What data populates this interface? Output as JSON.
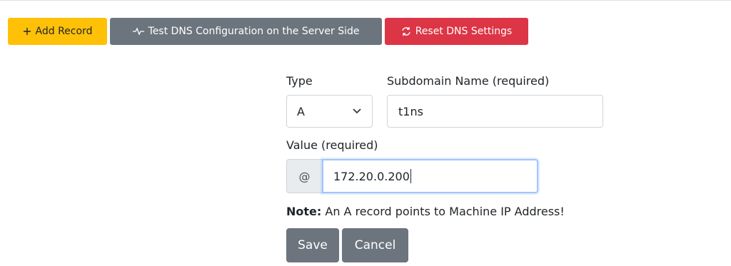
{
  "toolbar": {
    "add_record": {
      "label": "Add Record",
      "icon": "plus-icon"
    },
    "test_dns": {
      "label": "Test DNS Configuration on the Server Side",
      "icon": "pulse-icon"
    },
    "reset_dns": {
      "label": "Reset DNS Settings",
      "icon": "refresh-icon"
    }
  },
  "form": {
    "type_label": "Type",
    "type_value": "A",
    "subdomain_label": "Subdomain Name (required)",
    "subdomain_value": "t1ns",
    "value_label": "Value (required)",
    "value_prefix": "@",
    "value_value": "172.20.0.200",
    "note_prefix": "Note:",
    "note_text": " An A record points to Machine IP Address!",
    "save_label": "Save",
    "cancel_label": "Cancel"
  },
  "colors": {
    "warning": "#ffc107",
    "secondary": "#6c757d",
    "danger": "#dc3545",
    "focus_border": "#9ec5fe"
  }
}
